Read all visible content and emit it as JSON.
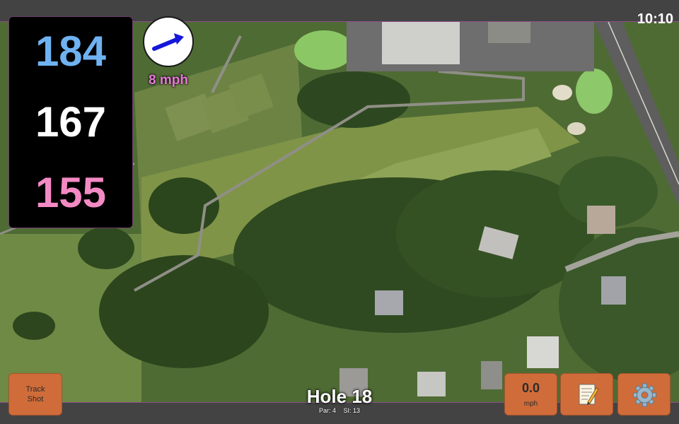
{
  "status": {
    "time": "10:10"
  },
  "distances": {
    "back": "184",
    "middle": "167",
    "front": "155"
  },
  "wind": {
    "speed_label": "8 mph",
    "arrow_direction": "east-northeast"
  },
  "hole": {
    "title": "Hole 18",
    "par": "Par: 4",
    "stroke_index": "SI: 13"
  },
  "buttons": {
    "track_line1": "Track",
    "track_line2": "Shot",
    "wind_value": "0.0",
    "wind_unit": "mph",
    "notes_icon": "memo-icon",
    "settings_icon": "gear-icon"
  },
  "colors": {
    "back_distance": "#6fb2f2",
    "middle_distance": "#ffffff",
    "front_distance": "#f48ac4",
    "button_accent": "#d06c3a",
    "wind_label": "#e878d8"
  }
}
